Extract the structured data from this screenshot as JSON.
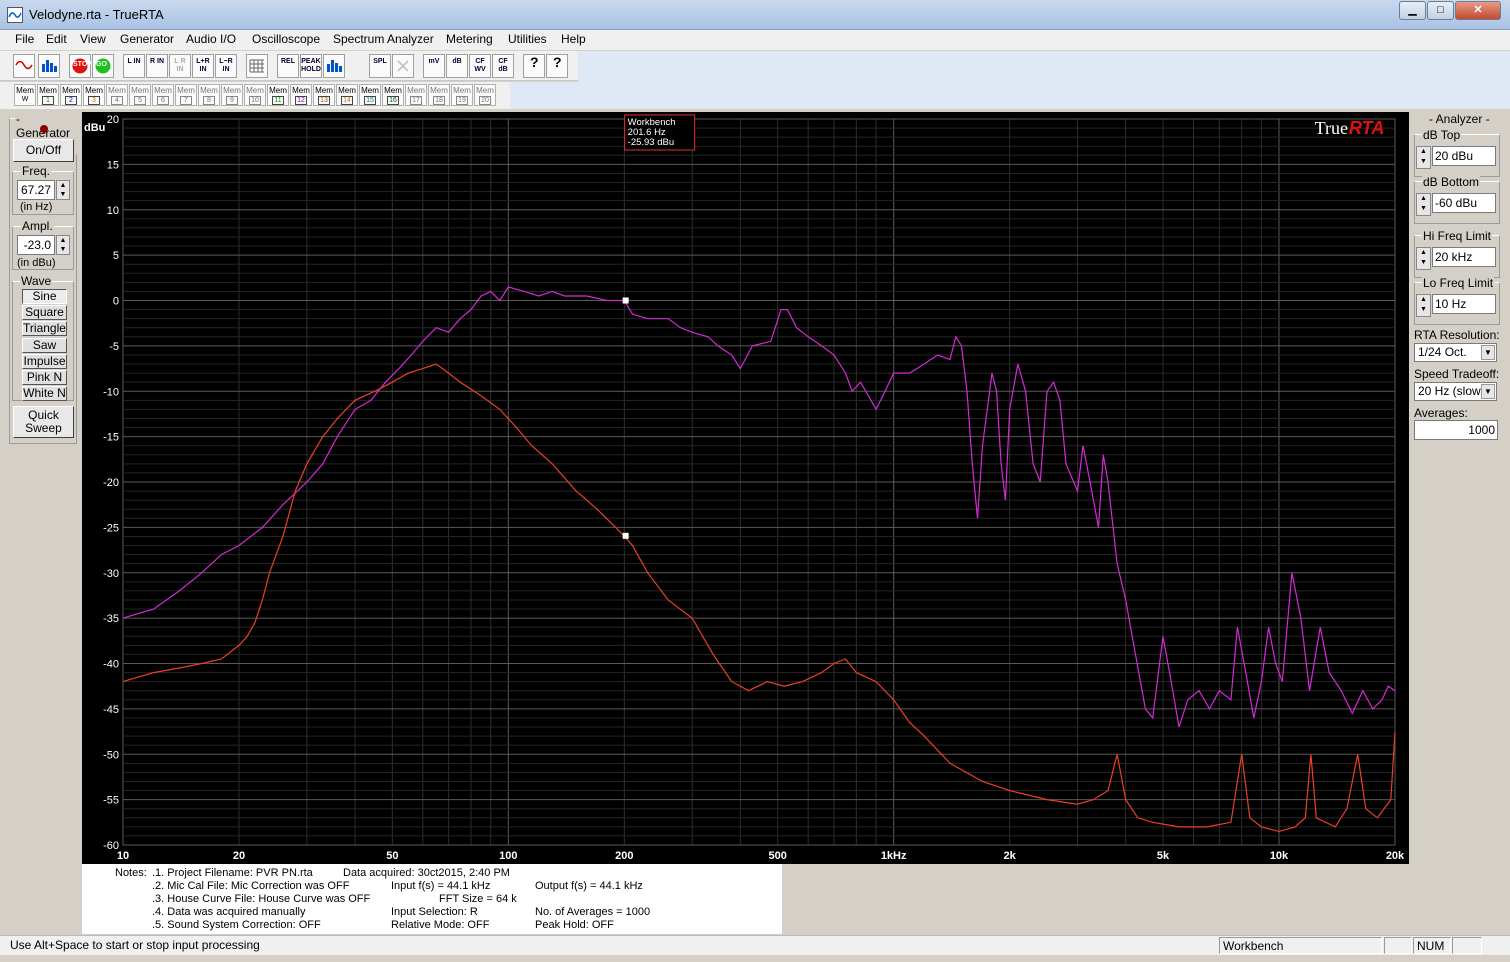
{
  "window": {
    "title": "Velodyne.rta - TrueRTA",
    "minimize": "▁",
    "maximize": "□",
    "close": "✕"
  },
  "menu": [
    "File",
    "Edit",
    "View",
    "Generator",
    "Audio I/O",
    "Oscilloscope",
    "Spectrum Analyzer",
    "Metering",
    "Utilities",
    "Help"
  ],
  "toolbar": {
    "buttons": [
      {
        "name": "sine-wave-button",
        "label": "",
        "icon": "sine-wave-icon"
      },
      {
        "name": "spectrum-button",
        "label": "",
        "icon": "spectrum-bars-icon"
      },
      {
        "name": "stop-button",
        "label": "STOP",
        "icon": "stop-icon"
      },
      {
        "name": "go-button",
        "label": "GO",
        "icon": "go-icon"
      },
      {
        "name": "l-in-button",
        "label": "L IN"
      },
      {
        "name": "r-in-button",
        "label": "R IN"
      },
      {
        "name": "l-r-in-button",
        "label": "L R IN"
      },
      {
        "name": "l-plus-r-in-button",
        "label": "L+R IN"
      },
      {
        "name": "l-minus-r-in-button",
        "label": "L−R IN"
      },
      {
        "name": "grid-button",
        "label": "",
        "icon": "grid-icon"
      },
      {
        "name": "rel-button",
        "label": "REL"
      },
      {
        "name": "peak-hold-button",
        "label": "PEAK HOLD"
      },
      {
        "name": "bar-graph-button",
        "label": "",
        "icon": "bar-graph-icon"
      },
      {
        "name": "spl-button",
        "label": "SPL"
      },
      {
        "name": "close-x-button",
        "label": "",
        "icon": "x-icon"
      },
      {
        "name": "mv-button",
        "label": "mV"
      },
      {
        "name": "db-button",
        "label": "dB"
      },
      {
        "name": "cf-wv-button",
        "label": "CF WV"
      },
      {
        "name": "cf-db-button",
        "label": "CF dB"
      },
      {
        "name": "help-button",
        "label": "?",
        "icon": "help-icon"
      },
      {
        "name": "context-help-button",
        "label": "?",
        "icon": "context-help-icon"
      }
    ],
    "memory_label": "Mem",
    "memory_slots": [
      "W",
      "1",
      "2",
      "3",
      "4",
      "5",
      "6",
      "7",
      "8",
      "9",
      "10",
      "11",
      "12",
      "13",
      "14",
      "15",
      "16",
      "17",
      "18",
      "19",
      "20"
    ],
    "memory_colors": {
      "1": "#00a000",
      "2": "#0000d0",
      "3": "#b08000",
      "11": "#00a000",
      "12": "#8000c0",
      "13": "#b06000",
      "14": "#c08000",
      "15": "#008080",
      "16": "#006000"
    }
  },
  "generator": {
    "title": "- Generator -",
    "on_off": "On/Off",
    "freq_label": "Freq.",
    "freq_value": "67.27",
    "freq_unit": "(in Hz)",
    "ampl_label": "Ampl.",
    "ampl_value": "-23.0",
    "ampl_unit": "(in dBu)",
    "wave_label": "Wave",
    "waves": [
      "Sine",
      "Square",
      "Triangle",
      "Saw",
      "Impulse",
      "Pink N",
      "White N"
    ],
    "selected_wave": "Sine",
    "quick_sweep": "Quick Sweep"
  },
  "analyzer": {
    "title": "- Analyzer -",
    "db_top_label": "dB Top",
    "db_top_value": "20 dBu",
    "db_bottom_label": "dB Bottom",
    "db_bottom_value": "-60 dBu",
    "hi_freq_label": "Hi Freq Limit",
    "hi_freq_value": "20 kHz",
    "lo_freq_label": "Lo Freq Limit",
    "lo_freq_value": "10 Hz",
    "rta_res_label": "RTA Resolution:",
    "rta_res_value": "1/24 Oct.",
    "speed_label": "Speed Tradeoff:",
    "speed_value": "20 Hz (slow)",
    "averages_label": "Averages:",
    "averages_value": "1000"
  },
  "chart_data": {
    "type": "line",
    "brand": "True",
    "brand_accent": "RTA",
    "ylabel": "dBu",
    "xscale": "log",
    "xlim": [
      10,
      20000
    ],
    "ylim": [
      -60,
      20
    ],
    "yticks": [
      20,
      15,
      10,
      5,
      0,
      -5,
      -10,
      -15,
      -20,
      -25,
      -30,
      -35,
      -40,
      -45,
      -50,
      -55,
      -60
    ],
    "xticks": [
      {
        "v": 10,
        "label": "10"
      },
      {
        "v": 20,
        "label": "20"
      },
      {
        "v": 50,
        "label": "50"
      },
      {
        "v": 100,
        "label": "100"
      },
      {
        "v": 200,
        "label": "200"
      },
      {
        "v": 500,
        "label": "500"
      },
      {
        "v": 1000,
        "label": "1kHz"
      },
      {
        "v": 2000,
        "label": "2k"
      },
      {
        "v": 5000,
        "label": "5k"
      },
      {
        "v": 10000,
        "label": "10k"
      },
      {
        "v": 20000,
        "label": "20k"
      }
    ],
    "grid": true,
    "marker_box": {
      "title": "Workbench",
      "freq": "201.6 Hz",
      "level": "-25.93 dBu"
    },
    "markers": [
      {
        "x": 201.6,
        "y": 0
      },
      {
        "x": 201.6,
        "y": -25.93
      }
    ],
    "series": [
      {
        "color": "#d42ad4",
        "points": [
          [
            10,
            -35
          ],
          [
            12,
            -34
          ],
          [
            14,
            -32
          ],
          [
            16,
            -30
          ],
          [
            18,
            -28
          ],
          [
            20,
            -27
          ],
          [
            23,
            -25
          ],
          [
            26,
            -22.5
          ],
          [
            30,
            -20
          ],
          [
            33,
            -18
          ],
          [
            36,
            -15
          ],
          [
            40,
            -12
          ],
          [
            44,
            -11
          ],
          [
            48,
            -9
          ],
          [
            52,
            -7.5
          ],
          [
            56,
            -6
          ],
          [
            60,
            -4.5
          ],
          [
            65,
            -3
          ],
          [
            70,
            -3.5
          ],
          [
            75,
            -2
          ],
          [
            80,
            -1
          ],
          [
            85,
            0.5
          ],
          [
            90,
            1
          ],
          [
            95,
            0
          ],
          [
            100,
            1.5
          ],
          [
            110,
            1
          ],
          [
            120,
            0.5
          ],
          [
            130,
            1
          ],
          [
            140,
            0.5
          ],
          [
            160,
            0.5
          ],
          [
            180,
            0
          ],
          [
            200,
            0
          ],
          [
            210,
            -1.5
          ],
          [
            230,
            -2
          ],
          [
            260,
            -2
          ],
          [
            280,
            -3
          ],
          [
            300,
            -3.5
          ],
          [
            330,
            -4
          ],
          [
            350,
            -5
          ],
          [
            380,
            -6
          ],
          [
            400,
            -7.5
          ],
          [
            430,
            -5
          ],
          [
            480,
            -4.5
          ],
          [
            510,
            -1
          ],
          [
            530,
            -1
          ],
          [
            560,
            -3
          ],
          [
            600,
            -4
          ],
          [
            650,
            -5
          ],
          [
            700,
            -6
          ],
          [
            750,
            -8
          ],
          [
            780,
            -10
          ],
          [
            820,
            -9
          ],
          [
            860,
            -10.5
          ],
          [
            900,
            -12
          ],
          [
            950,
            -10
          ],
          [
            1000,
            -8
          ],
          [
            1100,
            -8
          ],
          [
            1200,
            -7
          ],
          [
            1300,
            -6
          ],
          [
            1400,
            -6.5
          ],
          [
            1450,
            -4
          ],
          [
            1500,
            -5
          ],
          [
            1550,
            -10
          ],
          [
            1600,
            -18
          ],
          [
            1650,
            -24
          ],
          [
            1700,
            -16
          ],
          [
            1800,
            -8
          ],
          [
            1850,
            -10
          ],
          [
            1900,
            -18
          ],
          [
            1950,
            -22
          ],
          [
            2000,
            -12
          ],
          [
            2100,
            -7
          ],
          [
            2200,
            -10
          ],
          [
            2300,
            -18
          ],
          [
            2400,
            -20
          ],
          [
            2500,
            -10
          ],
          [
            2600,
            -9
          ],
          [
            2700,
            -11
          ],
          [
            2800,
            -18
          ],
          [
            3000,
            -21
          ],
          [
            3100,
            -16
          ],
          [
            3200,
            -19
          ],
          [
            3400,
            -25
          ],
          [
            3500,
            -17
          ],
          [
            3600,
            -20
          ],
          [
            3800,
            -29
          ],
          [
            4000,
            -33
          ],
          [
            4200,
            -38
          ],
          [
            4500,
            -45
          ],
          [
            4700,
            -46
          ],
          [
            5000,
            -37
          ],
          [
            5200,
            -41
          ],
          [
            5500,
            -47
          ],
          [
            5800,
            -44
          ],
          [
            6200,
            -43
          ],
          [
            6600,
            -45
          ],
          [
            7000,
            -43
          ],
          [
            7500,
            -44
          ],
          [
            7800,
            -36
          ],
          [
            8200,
            -41
          ],
          [
            8600,
            -46
          ],
          [
            9000,
            -42
          ],
          [
            9400,
            -36
          ],
          [
            9800,
            -40
          ],
          [
            10200,
            -42
          ],
          [
            10800,
            -30
          ],
          [
            11400,
            -35
          ],
          [
            12000,
            -43
          ],
          [
            12800,
            -36
          ],
          [
            13500,
            -41
          ],
          [
            14500,
            -43
          ],
          [
            15500,
            -45.5
          ],
          [
            16500,
            -43
          ],
          [
            17500,
            -45
          ],
          [
            18500,
            -44
          ],
          [
            19200,
            -42.5
          ],
          [
            20000,
            -43
          ]
        ]
      },
      {
        "color": "#e8402a",
        "points": [
          [
            10,
            -42
          ],
          [
            12,
            -41
          ],
          [
            14,
            -40.5
          ],
          [
            16,
            -40
          ],
          [
            18,
            -39.5
          ],
          [
            20,
            -38
          ],
          [
            21,
            -37
          ],
          [
            22,
            -35.5
          ],
          [
            23,
            -33
          ],
          [
            24,
            -30
          ],
          [
            26,
            -26
          ],
          [
            28,
            -21
          ],
          [
            30,
            -18
          ],
          [
            33,
            -15
          ],
          [
            36,
            -13
          ],
          [
            40,
            -11
          ],
          [
            45,
            -10
          ],
          [
            50,
            -9
          ],
          [
            55,
            -8
          ],
          [
            60,
            -7.5
          ],
          [
            65,
            -7
          ],
          [
            70,
            -8
          ],
          [
            75,
            -9
          ],
          [
            85,
            -10.5
          ],
          [
            95,
            -12
          ],
          [
            105,
            -14
          ],
          [
            115,
            -16
          ],
          [
            130,
            -18
          ],
          [
            150,
            -21
          ],
          [
            170,
            -23
          ],
          [
            190,
            -25
          ],
          [
            200,
            -26
          ],
          [
            210,
            -27
          ],
          [
            230,
            -30
          ],
          [
            260,
            -33
          ],
          [
            300,
            -35
          ],
          [
            340,
            -39
          ],
          [
            380,
            -42
          ],
          [
            420,
            -43
          ],
          [
            470,
            -42
          ],
          [
            520,
            -42.5
          ],
          [
            580,
            -42
          ],
          [
            650,
            -41
          ],
          [
            700,
            -40
          ],
          [
            750,
            -39.5
          ],
          [
            800,
            -41
          ],
          [
            900,
            -42
          ],
          [
            1000,
            -44
          ],
          [
            1100,
            -46.5
          ],
          [
            1200,
            -48
          ],
          [
            1400,
            -51
          ],
          [
            1700,
            -53
          ],
          [
            2000,
            -54
          ],
          [
            2500,
            -55
          ],
          [
            3000,
            -55.5
          ],
          [
            3300,
            -55
          ],
          [
            3600,
            -54
          ],
          [
            3800,
            -50
          ],
          [
            4000,
            -55
          ],
          [
            4300,
            -57
          ],
          [
            4700,
            -57.5
          ],
          [
            5500,
            -58
          ],
          [
            6500,
            -58
          ],
          [
            7500,
            -57.5
          ],
          [
            8000,
            -50
          ],
          [
            8400,
            -57
          ],
          [
            9000,
            -58
          ],
          [
            10000,
            -58.5
          ],
          [
            11000,
            -58
          ],
          [
            11700,
            -57
          ],
          [
            12100,
            -50
          ],
          [
            12500,
            -57
          ],
          [
            14000,
            -58
          ],
          [
            15000,
            -56
          ],
          [
            16000,
            -50
          ],
          [
            16800,
            -56
          ],
          [
            18000,
            -57
          ],
          [
            19500,
            -55
          ],
          [
            20000,
            -47.5
          ]
        ]
      }
    ]
  },
  "notes": {
    "label": "Notes:",
    "lines": [
      ".1. Project Filename: PVR PN.rta",
      ".2. Mic Cal File: Mic Correction was OFF",
      ".3. House Curve File: House Curve was OFF",
      ".4. Data was acquired manually",
      ".5. Sound System Correction: OFF"
    ],
    "col2": [
      "Data acquired: 30ct2015, 2:40 PM",
      "Input f(s) = 44.1 kHz",
      "FFT Size = 64 k",
      "Input Selection: R",
      "Relative Mode:  OFF"
    ],
    "col3": [
      "Output f(s) = 44.1 kHz",
      "No. of Averages = 1000",
      "Peak Hold: OFF"
    ]
  },
  "status": {
    "message": "Use Alt+Space to start or stop input processing",
    "workbench": "Workbench",
    "num": "NUM"
  }
}
